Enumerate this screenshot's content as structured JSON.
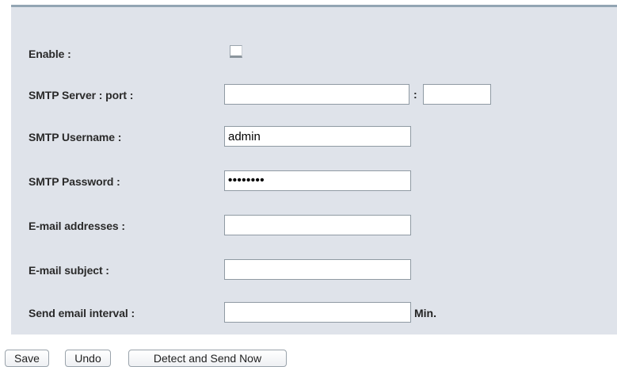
{
  "form": {
    "enable": {
      "label": "Enable :",
      "checked": false
    },
    "smtp_server": {
      "label": "SMTP Server : port :",
      "value": "",
      "separator": ":",
      "port_value": ""
    },
    "smtp_username": {
      "label": "SMTP Username :",
      "value": "admin"
    },
    "smtp_password": {
      "label": "SMTP Password :",
      "value": "••••••••"
    },
    "email_addresses": {
      "label": "E-mail addresses :",
      "value": ""
    },
    "email_subject": {
      "label": "E-mail subject :",
      "value": ""
    },
    "send_interval": {
      "label": "Send email interval :",
      "value": "",
      "unit": "Min."
    }
  },
  "buttons": {
    "save_label": "Save",
    "undo_label": "Undo",
    "detect_label": "Detect and Send Now"
  },
  "colors": {
    "panel_background": "#dfe3ea",
    "panel_top_border": "#93a5b3"
  }
}
